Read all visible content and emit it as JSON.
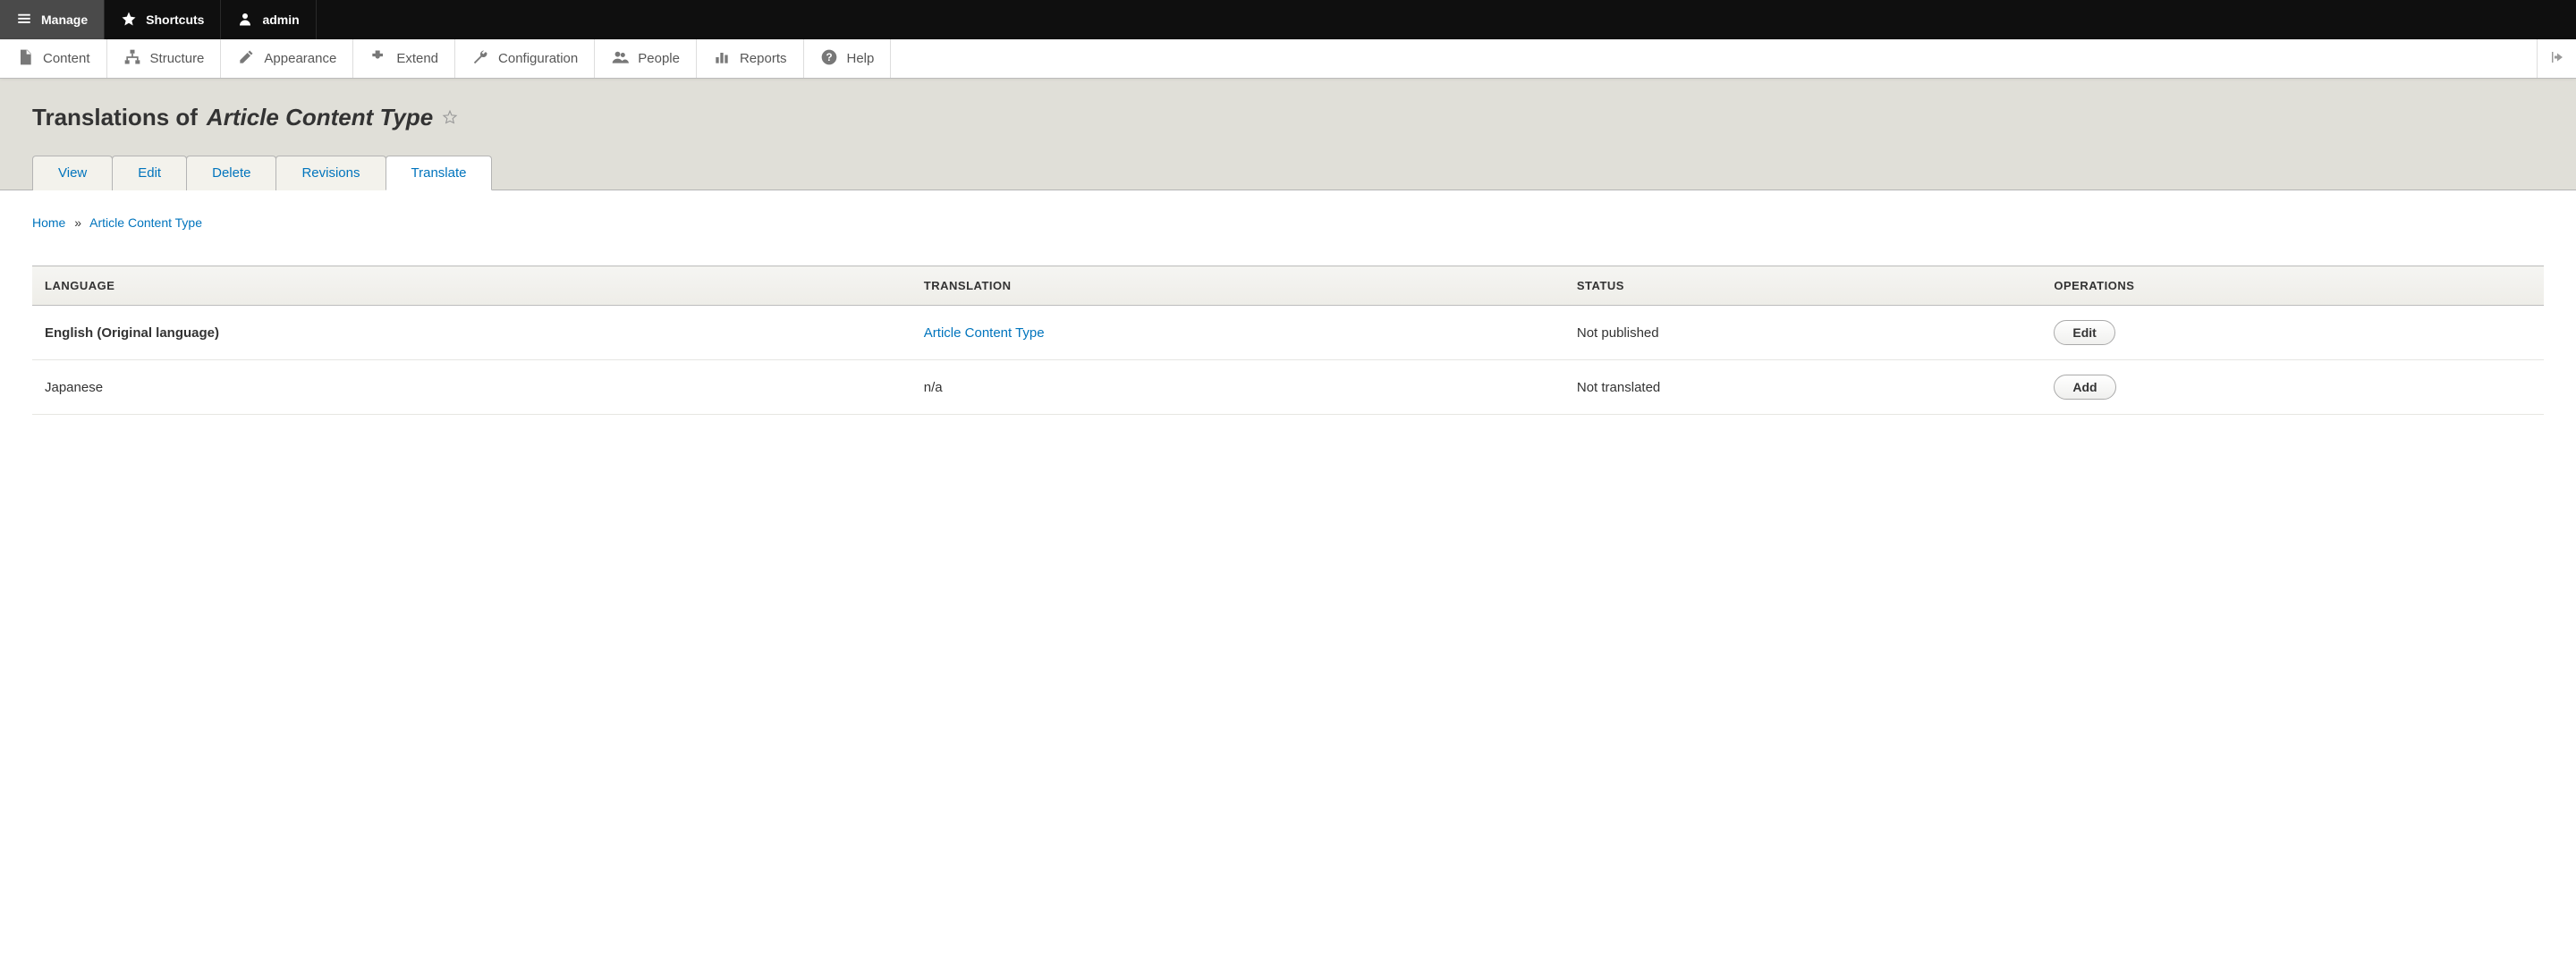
{
  "toolbar": {
    "manage": "Manage",
    "shortcuts": "Shortcuts",
    "user": "admin"
  },
  "adminMenu": {
    "content": "Content",
    "structure": "Structure",
    "appearance": "Appearance",
    "extend": "Extend",
    "configuration": "Configuration",
    "people": "People",
    "reports": "Reports",
    "help": "Help"
  },
  "pageTitle": {
    "prefix": "Translations of",
    "entity": "Article Content Type"
  },
  "tabs": {
    "view": "View",
    "edit": "Edit",
    "delete": "Delete",
    "revisions": "Revisions",
    "translate": "Translate"
  },
  "breadcrumb": {
    "home": "Home",
    "sep": "»",
    "current": "Article Content Type"
  },
  "table": {
    "headers": {
      "language": "LANGUAGE",
      "translation": "TRANSLATION",
      "status": "STATUS",
      "operations": "OPERATIONS"
    },
    "rows": [
      {
        "language": "English (Original language)",
        "original": true,
        "translation": "Article Content Type",
        "translationIsLink": true,
        "status": "Not published",
        "operation": "Edit"
      },
      {
        "language": "Japanese",
        "original": false,
        "translation": "n/a",
        "translationIsLink": false,
        "status": "Not translated",
        "operation": "Add"
      }
    ]
  }
}
